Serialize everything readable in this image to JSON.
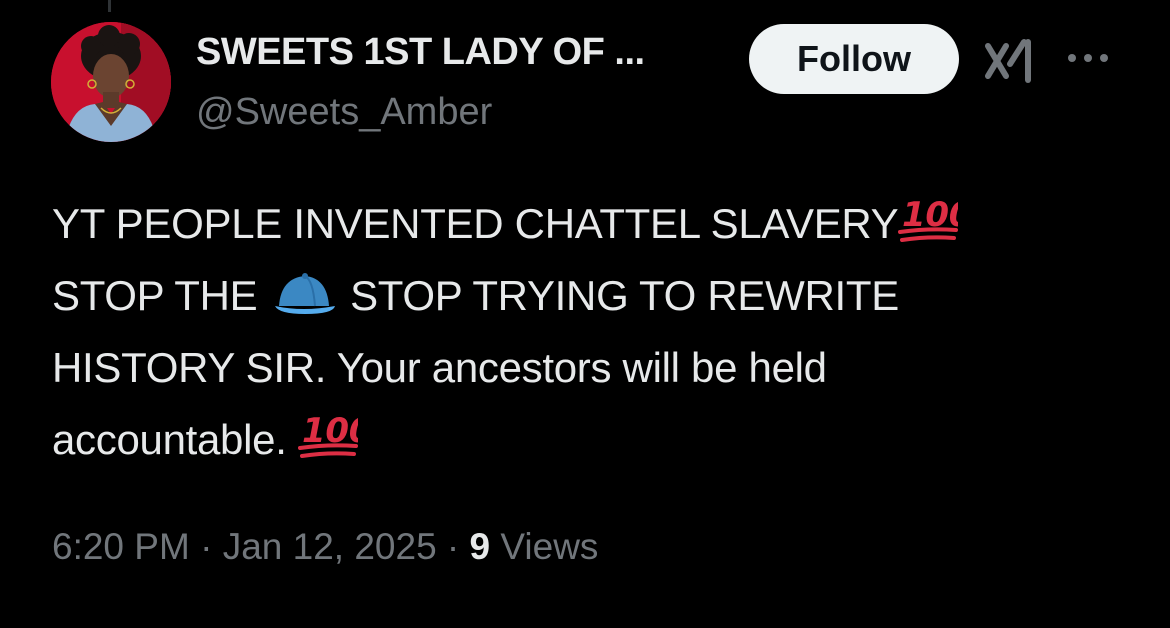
{
  "user": {
    "display_name": "SWEETS 1ST LADY OF ...",
    "handle": "@Sweets_Amber",
    "avatar_icon": "profile-photo"
  },
  "actions": {
    "follow_label": "Follow",
    "grok_icon": "grok-icon",
    "more_icon": "more-icon"
  },
  "tweet": {
    "line1": "YT PEOPLE INVENTED CHATTEL SLAVERY",
    "line2a": "STOP THE ",
    "line2b": " STOP TRYING TO REWRITE",
    "line3": "HISTORY SIR. Your ancestors will be held",
    "line4": "accountable. ",
    "emoji_hundred": "hundred-points-emoji",
    "emoji_cap": "cap-emoji"
  },
  "meta": {
    "time": "6:20 PM",
    "separator1": " · ",
    "date": "Jan 12, 2025",
    "separator2": " · ",
    "views_count": "9",
    "views_label": " Views"
  },
  "colors": {
    "background": "#000000",
    "text": "#e7e9ea",
    "muted": "#71767b",
    "follow_bg": "#eff3f4",
    "emoji_red": "#dd2e44",
    "cap_blue": "#3b88c3"
  }
}
